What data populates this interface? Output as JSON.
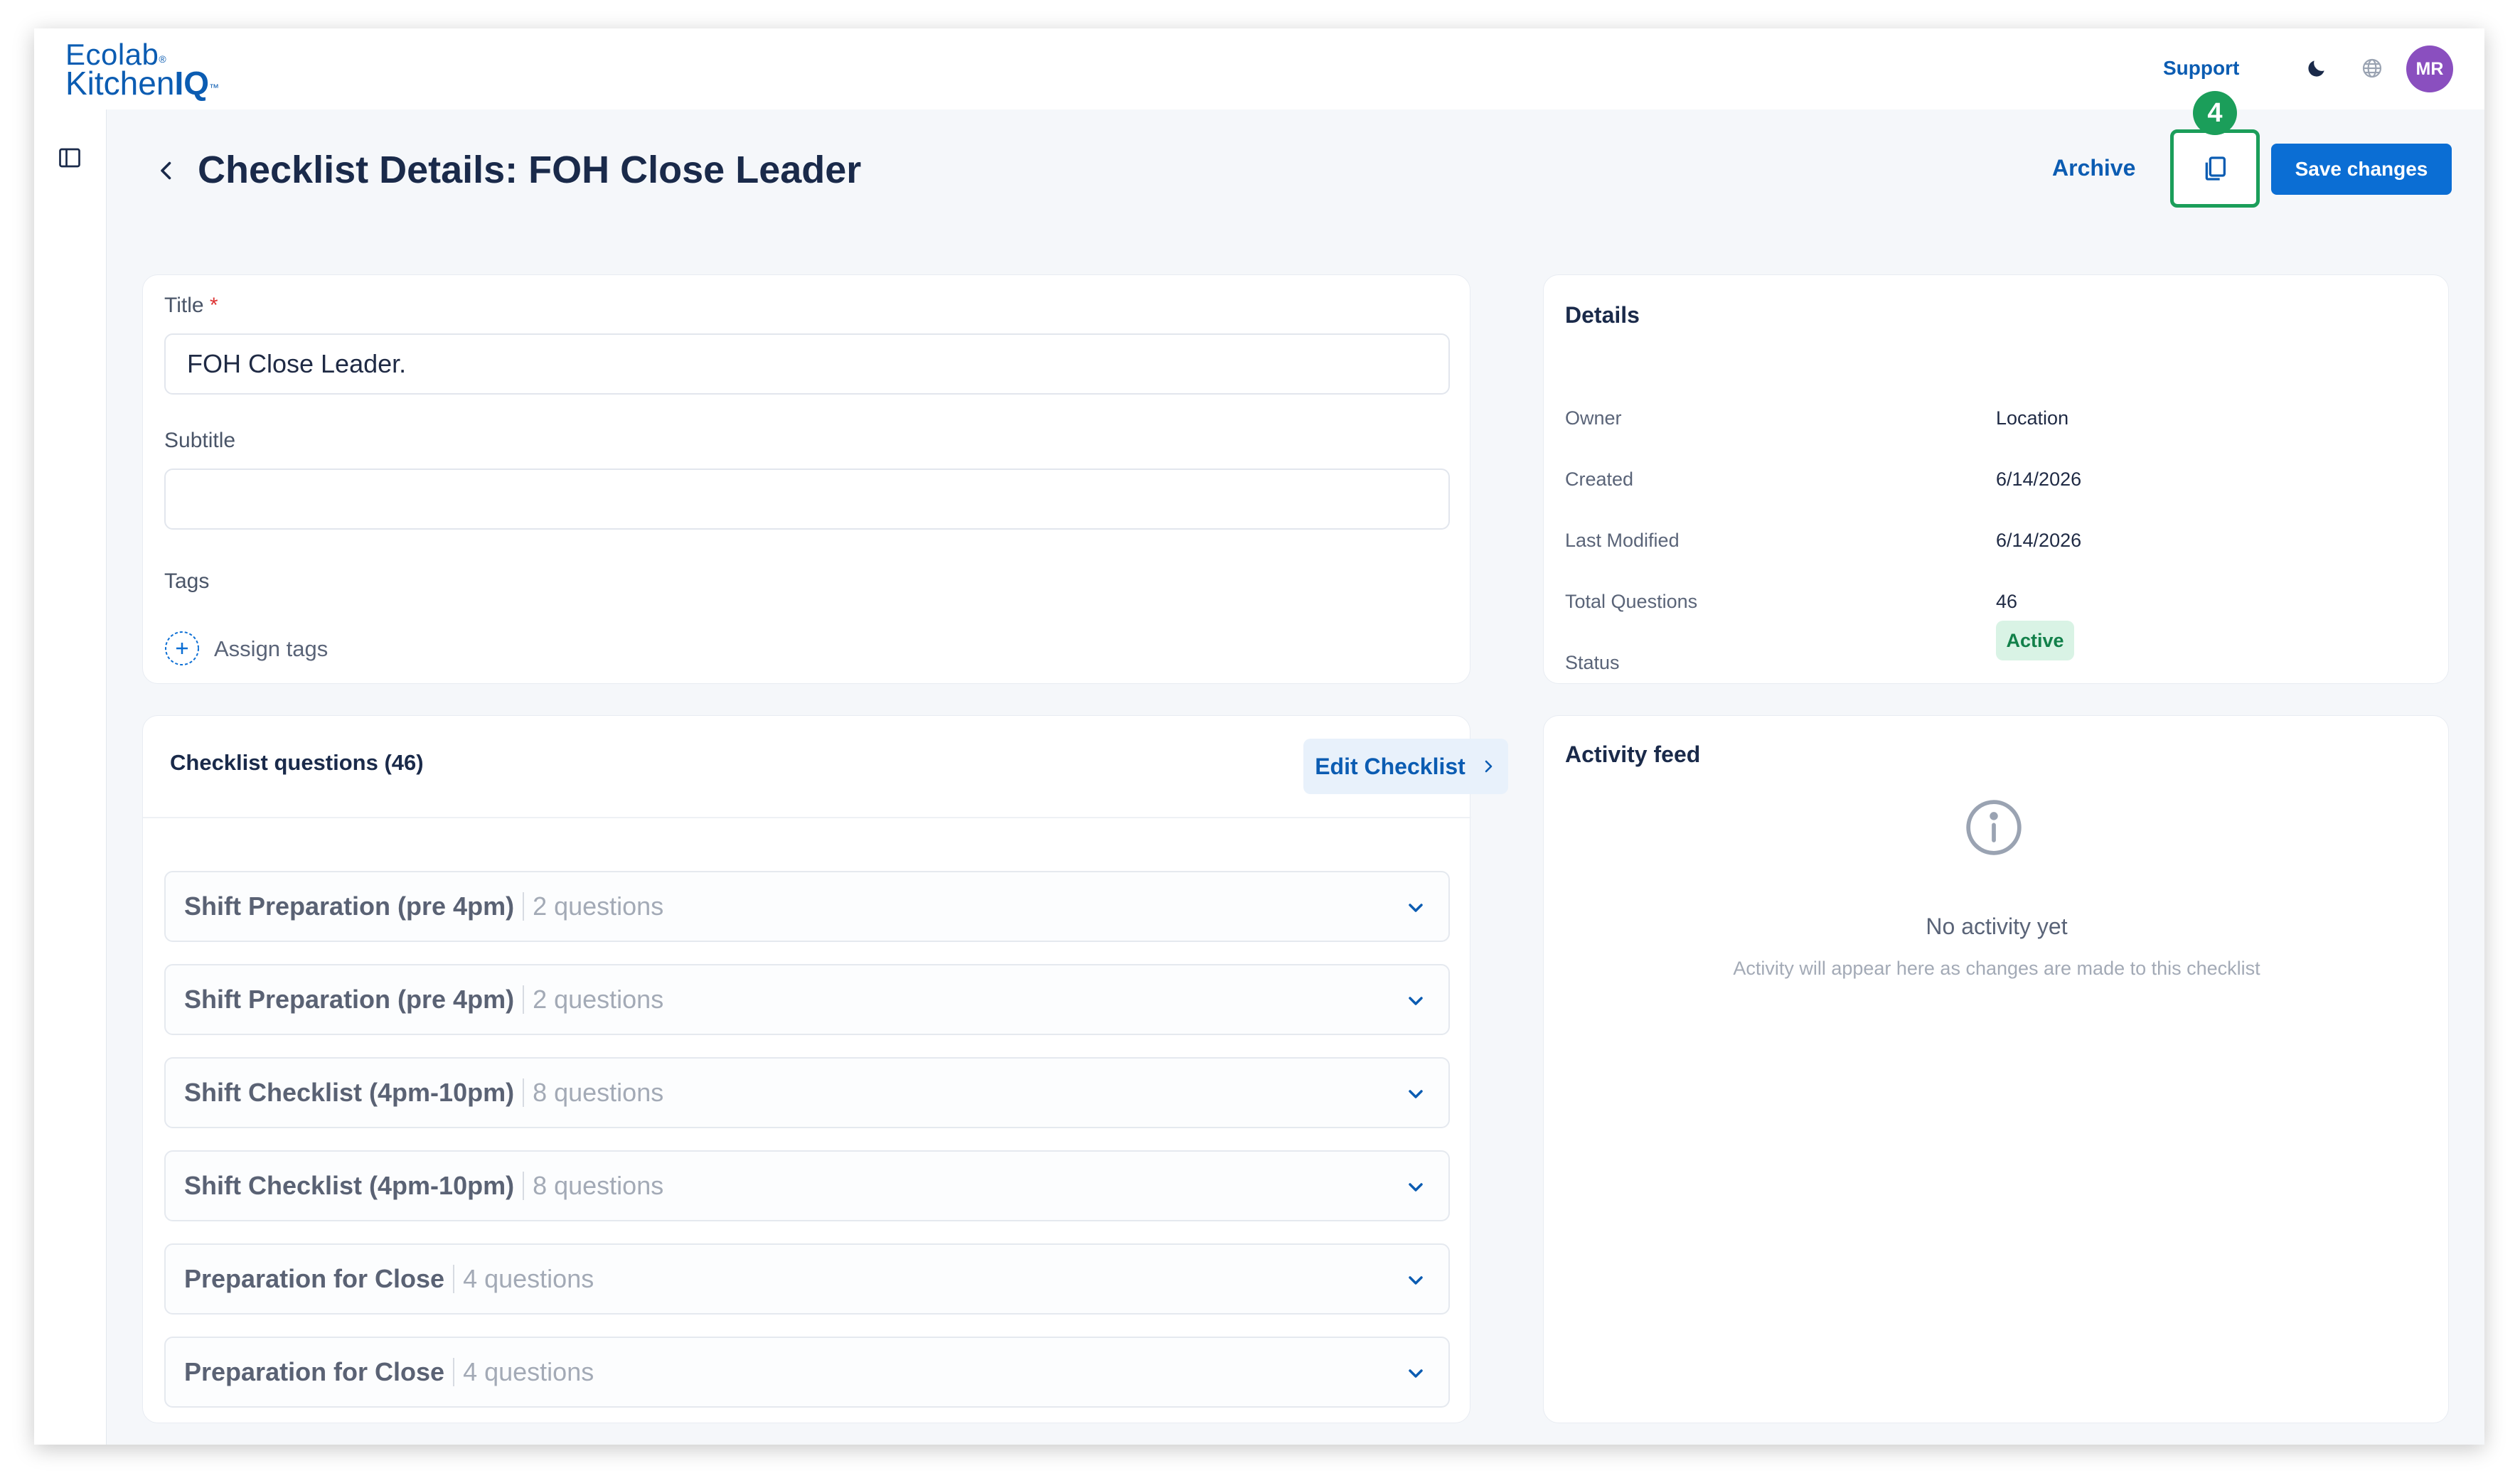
{
  "brand": {
    "line1": "Ecolab",
    "line2_prefix": "Kitchen",
    "line2_bold": "IQ"
  },
  "topbar": {
    "support_label": "Support",
    "avatar_initials": "MR",
    "icons": [
      "moon-icon",
      "globe-icon"
    ]
  },
  "header": {
    "title": "Checklist Details: FOH Close Leader",
    "archive_label": "Archive",
    "step_badge": "4",
    "save_label": "Save changes"
  },
  "form": {
    "title_label": "Title",
    "required_mark": "*",
    "title_value": "FOH Close Leader.",
    "subtitle_label": "Subtitle",
    "subtitle_value": "",
    "tags_label": "Tags",
    "assign_tags_label": "Assign tags"
  },
  "details": {
    "heading": "Details",
    "rows": [
      {
        "key": "Owner",
        "value": "Location"
      },
      {
        "key": "Created",
        "value": "6/14/2026"
      },
      {
        "key": "Last Modified",
        "value": "6/14/2026"
      },
      {
        "key": "Total Questions",
        "value": "46"
      },
      {
        "key": "Status",
        "value": "Active"
      }
    ]
  },
  "questions": {
    "heading": "Checklist questions (46)",
    "edit_label": "Edit Checklist",
    "sections": [
      {
        "name": "Shift Preparation (pre 4pm)",
        "count": "2 questions"
      },
      {
        "name": "Shift Preparation (pre 4pm)",
        "count": "2 questions"
      },
      {
        "name": "Shift Checklist (4pm-10pm)",
        "count": "8 questions"
      },
      {
        "name": "Shift Checklist (4pm-10pm)",
        "count": "8 questions"
      },
      {
        "name": "Preparation for Close",
        "count": "4 questions"
      },
      {
        "name": "Preparation for Close",
        "count": "4 questions"
      }
    ]
  },
  "activity": {
    "heading": "Activity feed",
    "empty_title": "No activity yet",
    "empty_sub": "Activity will appear here as changes are made to this checklist"
  },
  "colors": {
    "brand": "#0b5cb2",
    "primary_button": "#0b6ed4",
    "highlight": "#1b9e5a",
    "status_bg": "#d9f3e5",
    "avatar": "#8a4fbf"
  }
}
